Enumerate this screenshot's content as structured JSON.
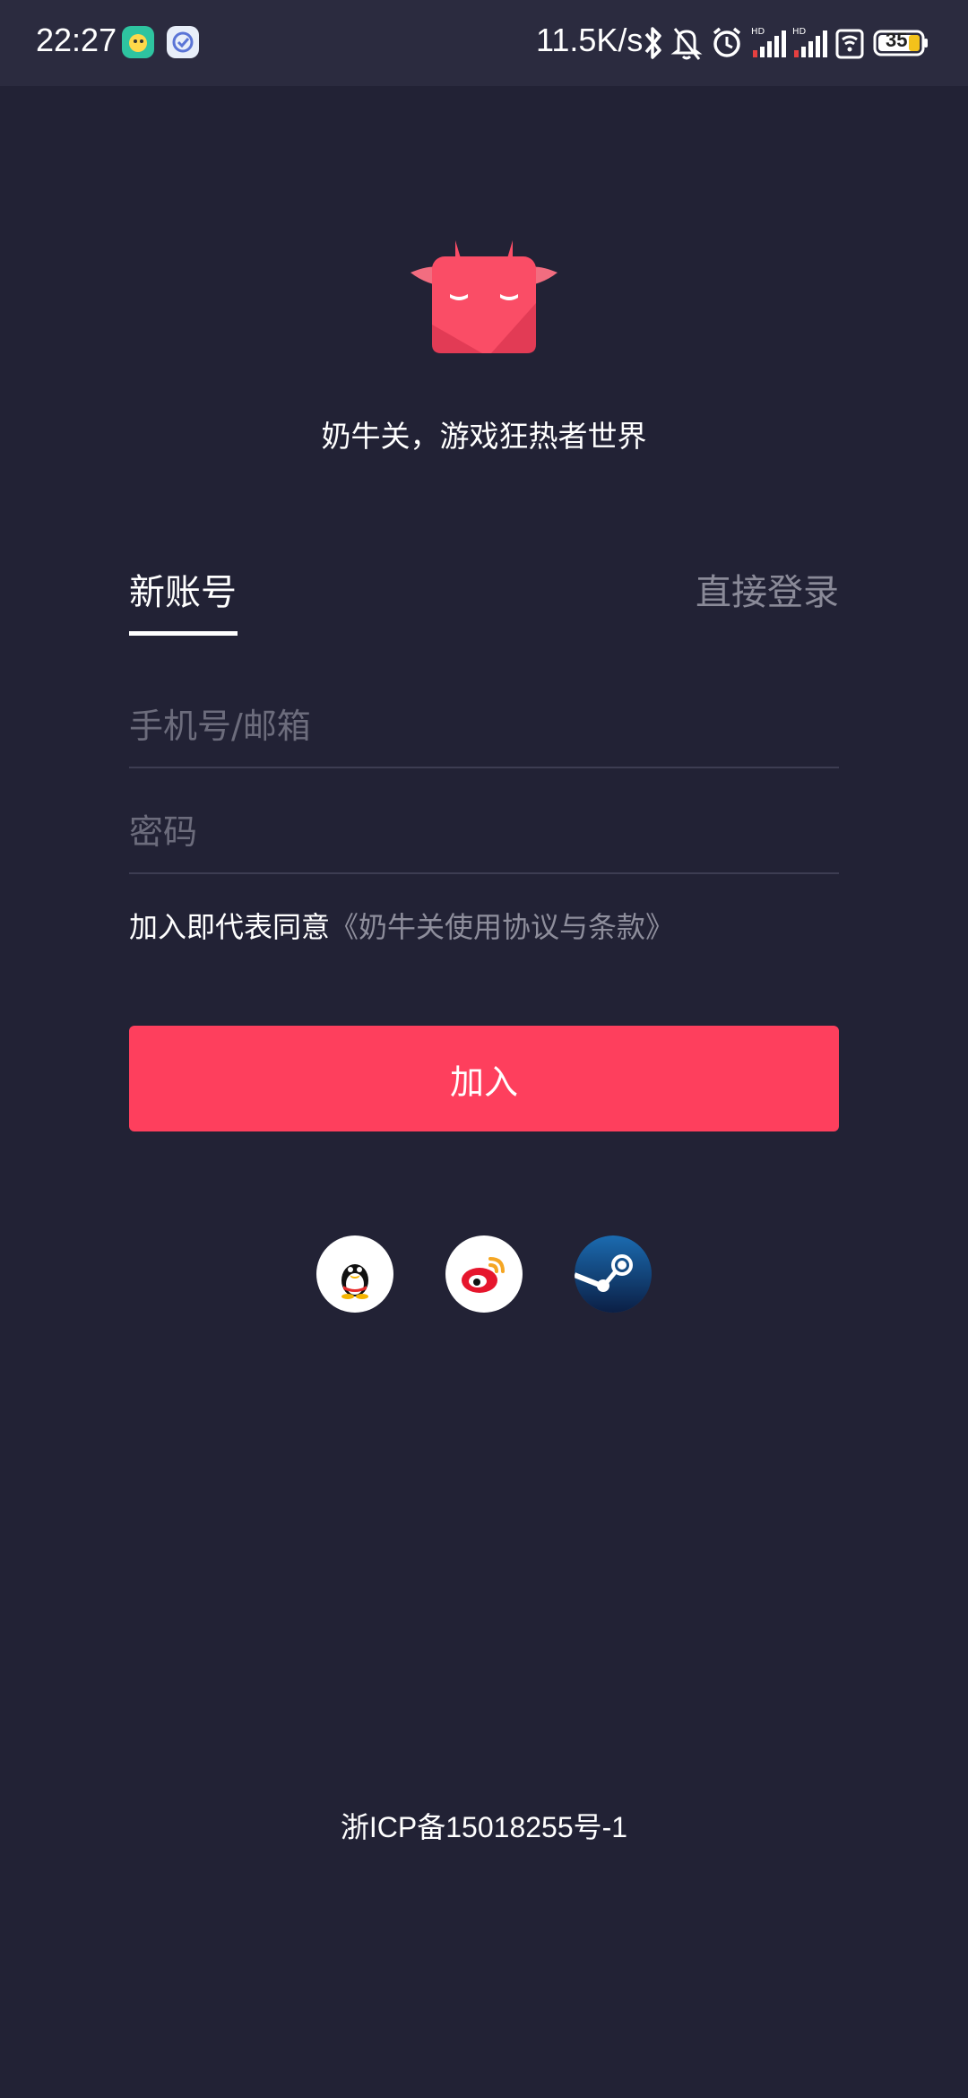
{
  "status_bar": {
    "time": "22:27",
    "network_speed": "11.5K/s",
    "battery_level": "35",
    "icons": [
      "app-icon-green",
      "app-icon-clock",
      "bluetooth-icon",
      "mute-icon",
      "alarm-icon",
      "signal-icon",
      "signal-icon",
      "wifi-icon",
      "battery-icon"
    ]
  },
  "brand": {
    "slogan": "奶牛关，游戏狂热者世界",
    "accent_color": "#fe3f5d",
    "background_color": "#222235"
  },
  "tabs": [
    {
      "label": "新账号",
      "active": true
    },
    {
      "label": "直接登录",
      "active": false
    }
  ],
  "form": {
    "phone_placeholder": "手机号/邮箱",
    "password_placeholder": "密码",
    "agreement_prefix": "加入即代表同意",
    "agreement_link": "《奶牛关使用协议与条款》",
    "submit_label": "加入"
  },
  "social": [
    "qq-icon",
    "weibo-icon",
    "steam-icon"
  ],
  "footer": {
    "icp": "浙ICP备15018255号-1"
  }
}
